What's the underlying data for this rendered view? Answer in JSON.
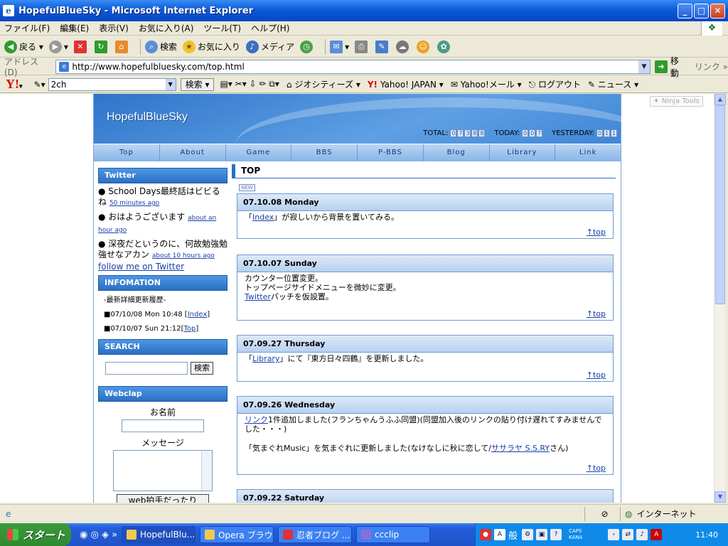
{
  "window": {
    "title": "HopefulBlueSky - Microsoft Internet Explorer"
  },
  "menu": [
    "ファイル(F)",
    "編集(E)",
    "表示(V)",
    "お気に入り(A)",
    "ツール(T)",
    "ヘルプ(H)"
  ],
  "toolbar": {
    "back": "戻る",
    "search": "検索",
    "favorites": "お気に入り",
    "media": "メディア"
  },
  "address": {
    "label": "アドレス(D)",
    "url": "http://www.hopefulbluesky.com/top.html",
    "go": "移動",
    "links": "リンク"
  },
  "yahoo_bar": {
    "logo": "Y!",
    "search_value": "2ch",
    "search_button": "検索",
    "items": [
      "ジオシティーズ",
      "Yahoo! JAPAN",
      "Yahoo!メール",
      "ログアウト",
      "ニュース"
    ]
  },
  "page": {
    "ninja": "Ninja Tools",
    "site_title": "HopefulBlueSky",
    "counters": {
      "total_label": "TOTAL:",
      "total": [
        "0",
        "7",
        "3",
        "8",
        "8"
      ],
      "today_label": "TODAY:",
      "today": [
        "0",
        "0",
        "7"
      ],
      "yesterday_label": "YESTERDAY:",
      "yesterday": [
        "0",
        "1",
        "1"
      ]
    },
    "nav": [
      "Top",
      "About",
      "Game",
      "BBS",
      "P-BBS",
      "Blog",
      "Library",
      "Link"
    ],
    "sidebar": {
      "twitter_title": "Twitter",
      "tweets": [
        {
          "text": "School Days最終話はビビるね",
          "time": "50 minutes ago"
        },
        {
          "text": "おはようございます",
          "time": "about an hour ago"
        },
        {
          "text": "深夜だというのに、何故勉強勉強せなアカン",
          "time": "about 10 hours ago"
        }
      ],
      "follow": "follow me on Twitter",
      "info_title": "INFOMATION",
      "info_head": "-最新詳細更新履歴-",
      "info_items": [
        {
          "date": "■07/10/08 Mon 10:48",
          "link": "Index"
        },
        {
          "date": "■07/10/07 Sun 21:12",
          "link": "Top"
        }
      ],
      "search_title": "SEARCH",
      "search_button": "検索",
      "webclap_title": "Webclap",
      "name_label": "お名前",
      "message_label": "メッセージ",
      "clap_button": "web拍手だったり"
    },
    "main_title": "TOP",
    "new_badge": "NEW",
    "entries": [
      {
        "date": "07.10.08 Monday",
        "pre": "「",
        "link": "Index",
        "post": "」が寂しいから背景を置いてみる。"
      },
      {
        "date": "07.10.07 Sunday",
        "line1": "カウンター位置変更。",
        "line2": "トップページサイドメニューを微妙に変更。",
        "link": "Twitter",
        "post": "パッチを仮設置。"
      },
      {
        "date": "07.09.27 Thursday",
        "pre": "「",
        "link": "Library",
        "post": "」にて『東方日々四鶴』を更新しました。"
      },
      {
        "date": "07.09.26 Wednesday",
        "link": "リンク",
        "post": "1件追加しました(フランちゃんうふふ同盟)(同盟加入後のリンクの貼り付け遅れてすみませんでした・・・)",
        "line2_pre": "「気まぐれMusic」を気まぐれに更新しました(なけなしに秋に恋して/",
        "line2_link": "ササラヤ S.S.RY",
        "line2_post": "さん)"
      },
      {
        "date": "07.09.22 Saturday"
      }
    ],
    "top_link": "↑top"
  },
  "statusbar": {
    "zone": "インターネット"
  },
  "taskbar": {
    "start": "スタート",
    "tasks": [
      "HopefulBlu...",
      "Opera ブラウ...",
      "忍者ブログ ...",
      "ccclip"
    ],
    "tray_text": "般",
    "caps": "CAPS",
    "kana": "KANA",
    "clock": "11:40"
  }
}
